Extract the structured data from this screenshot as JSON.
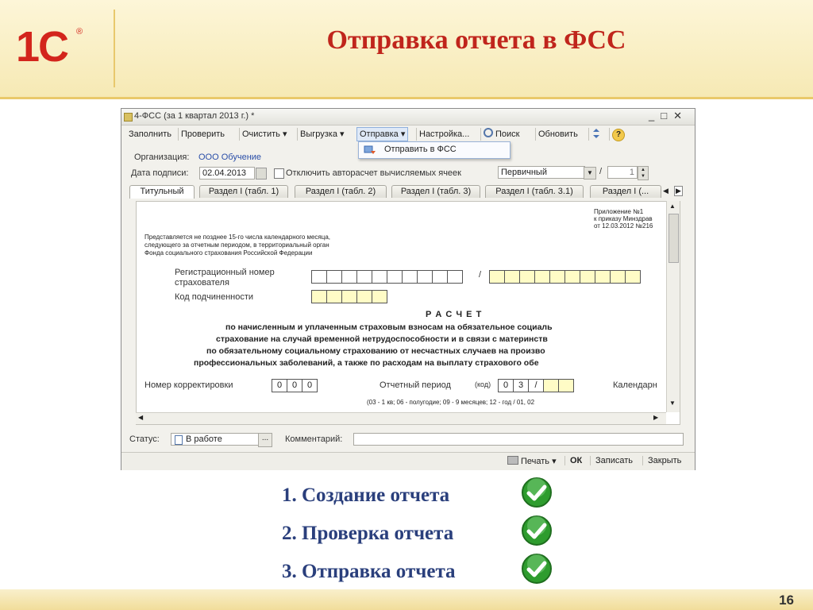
{
  "slide": {
    "logo": "1С",
    "logo_mark": "®",
    "title": "Отправка отчета в ФСС",
    "page_number": "16"
  },
  "window": {
    "title": "4-ФСС (за 1 квартал 2013 г.) *",
    "controls": [
      "_",
      "□",
      "✕"
    ]
  },
  "toolbar": {
    "fill": "Заполнить",
    "check": "Проверить",
    "clear": "Очистить ▾",
    "upload": "Выгрузка ▾",
    "send": "Отправка ▾",
    "settings": "Настройка...",
    "search": "Поиск",
    "refresh": "Обновить",
    "help": "?"
  },
  "send_menu": {
    "item": "Отправить в ФСС"
  },
  "form": {
    "org_label": "Организация:",
    "org_value": "ООО Обучение",
    "sign_date_label": "Дата подписи:",
    "sign_date_value": "02.04.2013",
    "autocalc_label": "Отключить авторасчет вычисляемых ячеек",
    "report_type": "Первичный",
    "slash": "/",
    "copy_number": "1"
  },
  "tabs": [
    "Титульный",
    "Раздел I (табл. 1)",
    "Раздел I (табл. 2)",
    "Раздел I (табл. 3)",
    "Раздел I (табл. 3.1)",
    "Раздел I (..."
  ],
  "doc": {
    "appendix_1": "Приложение №1",
    "appendix_2": "к приказу Минздрав",
    "appendix_3": "от 12.03.2012 №216",
    "note_1": "Представляется не позднее 15-го числа календарного месяца,",
    "note_2": "следующего за отчетным периодом, в территориальный орган",
    "note_3": "Фонда социального страхования Российской Федерации",
    "reg_label_1": "Регистрационный номер",
    "reg_label_2": "страхователя",
    "sub_label": "Код подчиненности",
    "raschet": "Р А С Ч Е Т",
    "line_1": "по начисленным и уплаченным страховым взносам на обязательное социаль",
    "line_2": "страхование на случай временной нетрудоспособности и в связи с материнств",
    "line_3": "по обязательному социальному страхованию от несчастных случаев на произво",
    "line_4": "профессиональных заболеваний, а также по расходам на выплату страхового обе",
    "correction_label": "Номер корректировки",
    "correction_digits": [
      "0",
      "0",
      "0"
    ],
    "period_label": "Отчетный период",
    "period_code_label": "(код)",
    "period_digits": [
      "0",
      "3",
      "/"
    ],
    "calendar_label": "Календарн",
    "period_hint_1": "(03 - 1 кв; 06 - полугодие; 09 - 9 месяцев; 12 - год / 01, 02",
    "slash_reg": "/"
  },
  "status": {
    "status_label": "Статус:",
    "status_value": "В работе",
    "ellipsis": "...",
    "comment_label": "Комментарий:"
  },
  "bottom": {
    "print": "Печать ▾",
    "ok": "ОК",
    "save": "Записать",
    "close": "Закрыть"
  },
  "steps": [
    "1. Создание отчета",
    "2. Проверка отчета",
    "3. Отправка отчета"
  ],
  "colors": {
    "title_red": "#c0251c",
    "step_blue": "#2a3f7c",
    "check_green": "#2e9c2e"
  }
}
